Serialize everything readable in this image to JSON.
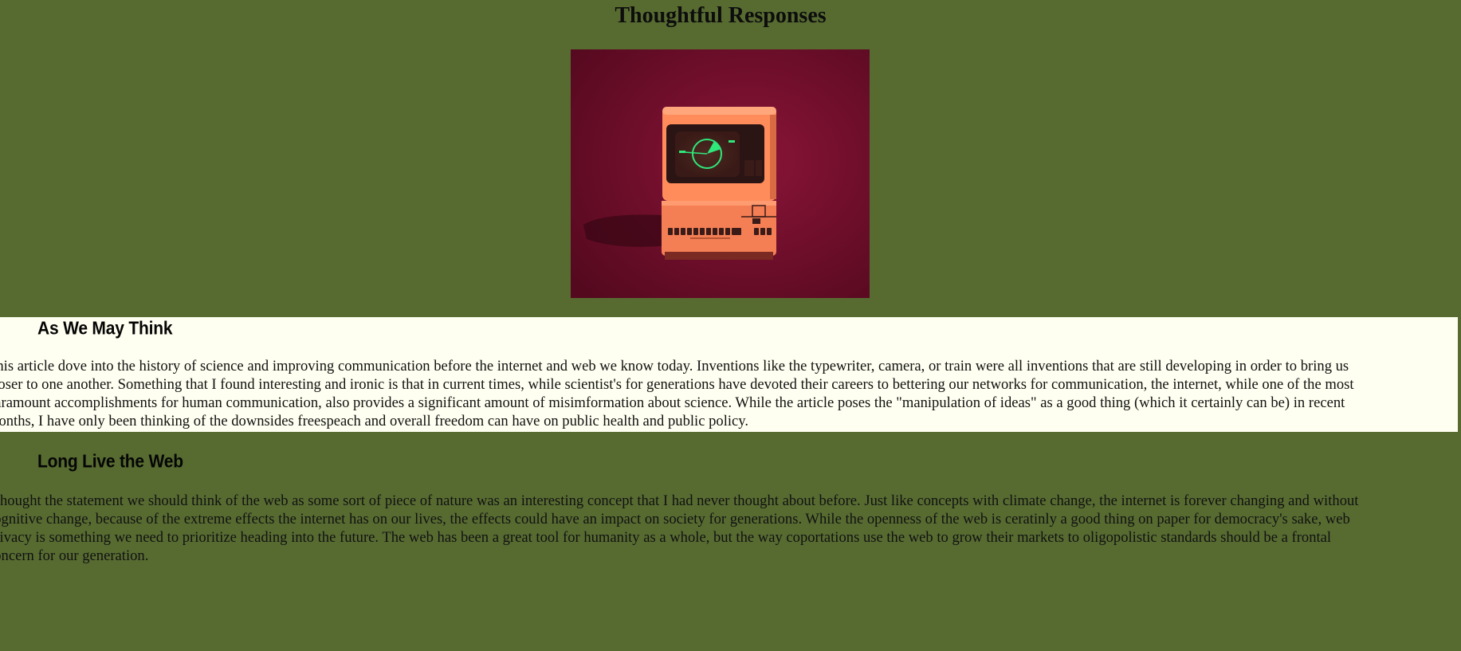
{
  "page": {
    "title": "Thoughtful Responses",
    "background_color": "#576b31"
  },
  "hero_image": {
    "subject": "retro-computer-illustration",
    "background_color": "#6a0f2e",
    "computer_color": "#ff8c5a",
    "screen_glow_color": "#2ee87a"
  },
  "sections": [
    {
      "heading": "As We May Think",
      "background_color": "#fffff1",
      "lines": [
        "This article dove into the history of science and improving communication before the internet and web we know today. Inventions like the typewriter, camera, or train were all inventions that are still developing in order to bring us",
        "closer to one another. Something that I found interesting and ironic is that in current times, while scientist's for generations have devoted their careers to bettering our networks for communication, the internet, while one of the most",
        "paramount accomplishments for human communication, also provides a significant amount of misimformation about science. While the article poses the \"manipulation of ideas\" as a good thing (which it certainly can be) in recent",
        "months, I have only been thinking of the downsides freespeach and overall freedom can have on public health and public policy."
      ]
    },
    {
      "heading": "Long Live the Web",
      "background_color": "#576b31",
      "lines": [
        "I thought the statement we should think of the web as some sort of piece of nature was an interesting concept that I had never thought about before. Just like concepts with climate change, the internet is forever changing and without",
        "cognitive change, because of the extreme effects the internet has on our lives, the effects could have an impact on society for generations. While the openness of the web is ceratinly a good thing on paper for democracy's sake, web",
        "privacy is something we need to prioritize heading into the future. The web has been a great tool for humanity as a whole, but the way coportations use the web to grow their markets to oligopolistic standards should be a frontal",
        "concern for our generation."
      ]
    }
  ]
}
